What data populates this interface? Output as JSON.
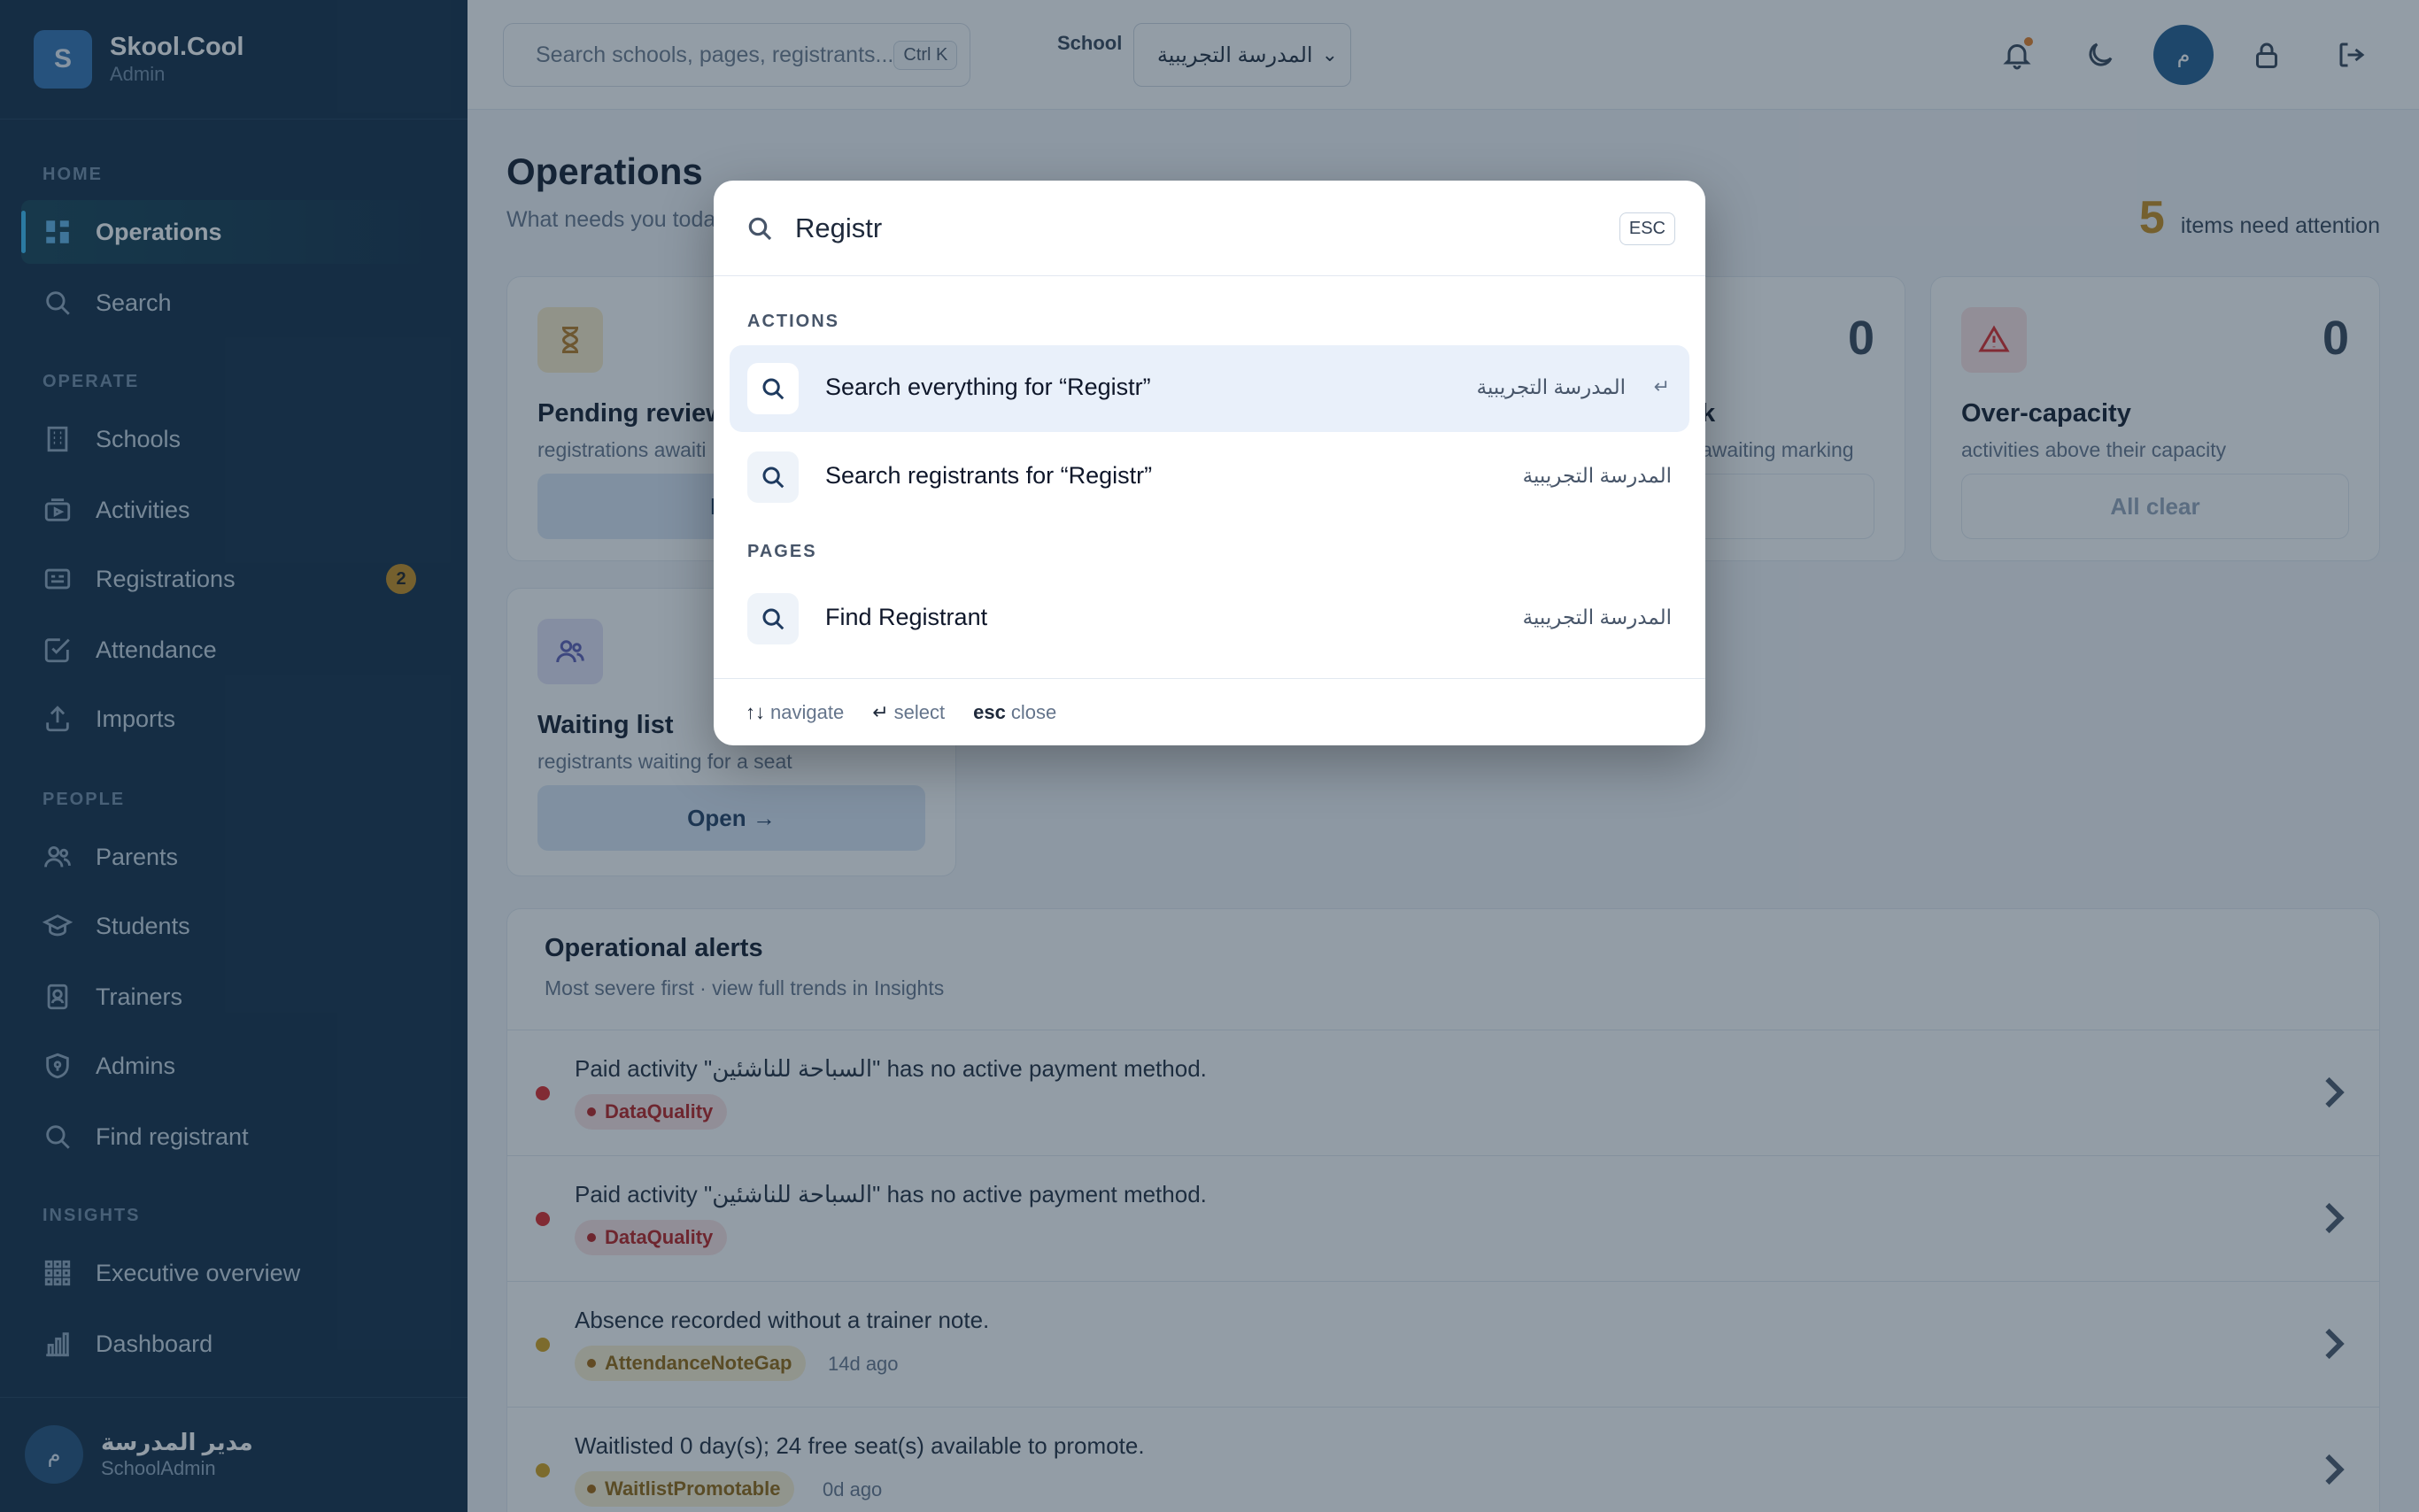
{
  "app": {
    "name": "Skool.Cool",
    "role": "Admin",
    "logo_letter": "S"
  },
  "sidebar": {
    "sections": [
      {
        "label": "HOME",
        "items": [
          {
            "label": "Operations",
            "icon": "dashboard-icon",
            "active": true
          },
          {
            "label": "Search",
            "icon": "search-icon"
          }
        ]
      },
      {
        "label": "OPERATE",
        "items": [
          {
            "label": "Schools",
            "icon": "building-icon"
          },
          {
            "label": "Activities",
            "icon": "activity-icon"
          },
          {
            "label": "Registrations",
            "icon": "id-card-icon",
            "badge": "2"
          },
          {
            "label": "Attendance",
            "icon": "check-square-icon"
          },
          {
            "label": "Imports",
            "icon": "upload-icon"
          }
        ]
      },
      {
        "label": "PEOPLE",
        "items": [
          {
            "label": "Parents",
            "icon": "users-icon"
          },
          {
            "label": "Students",
            "icon": "graduation-cap-icon"
          },
          {
            "label": "Trainers",
            "icon": "badge-icon"
          },
          {
            "label": "Admins",
            "icon": "shield-icon"
          },
          {
            "label": "Find registrant",
            "icon": "search-icon"
          }
        ]
      },
      {
        "label": "INSIGHTS",
        "items": [
          {
            "label": "Executive overview",
            "icon": "grid-icon"
          },
          {
            "label": "Dashboard",
            "icon": "bar-chart-icon"
          }
        ]
      }
    ],
    "user": {
      "name": "مدير المدرسة",
      "role": "SchoolAdmin",
      "initial": "م"
    }
  },
  "topbar": {
    "search_placeholder": "Search schools, pages, registrants...",
    "search_shortcut": "Ctrl K",
    "school_label": "School",
    "school_selected": "المدرسة التجريبية",
    "avatar_initial": "م"
  },
  "main": {
    "title": "Operations",
    "subtitle": "What needs you toda",
    "attention_count": "5",
    "attention_text": "items need attention",
    "cards": [
      {
        "title": "Pending review",
        "desc": "registrations awaiti",
        "button": "Rev"
      },
      {
        "count": "0",
        "title": "k",
        "desc": "awaiting marking",
        "button": "ar"
      },
      {
        "count": "0",
        "title": "Over-capacity",
        "desc": "activities above their capacity",
        "button": "All clear"
      },
      {
        "title": "Waiting list",
        "desc": "registrants waiting for a seat",
        "button": "Open →"
      }
    ],
    "alerts": {
      "title": "Operational alerts",
      "subtitle": "Most severe first · view full trends in Insights",
      "rows": [
        {
          "text": "Paid activity \"السباحة للناشئين\" has no active payment method.",
          "tag": "DataQuality",
          "time": ""
        },
        {
          "text": "Paid activity \"السباحة للناشئين\" has no active payment method.",
          "tag": "DataQuality",
          "time": ""
        },
        {
          "text": "Absence recorded without a trainer note.",
          "tag": "AttendanceNoteGap",
          "time": "14d ago"
        },
        {
          "text": "Waitlisted 0 day(s); 24 free seat(s) available to promote.",
          "tag": "WaitlistPromotable",
          "time": "0d ago"
        }
      ]
    }
  },
  "palette": {
    "query": "Registr",
    "esc_label": "ESC",
    "groups": [
      {
        "label": "ACTIONS",
        "results": [
          {
            "label": "Search everything for “Registr”",
            "school": "المدرسة التجريبية",
            "active": true,
            "enter": "↵"
          },
          {
            "label": "Search registrants for “Registr”",
            "school": "المدرسة التجريبية"
          }
        ]
      },
      {
        "label": "PAGES",
        "results": [
          {
            "label": "Find Registrant",
            "school": "المدرسة التجريبية"
          }
        ]
      }
    ],
    "footer": {
      "nav_key": "↑↓",
      "nav_label": "navigate",
      "select_key": "↵",
      "select_label": "select",
      "close_key": "esc",
      "close_label": "close"
    }
  },
  "colors": {
    "sidebar_bg": "#0f2a44",
    "accent": "#c68b1a",
    "primary": "#1f5a8e",
    "danger": "#dc2626",
    "warning": "#d4a017"
  }
}
